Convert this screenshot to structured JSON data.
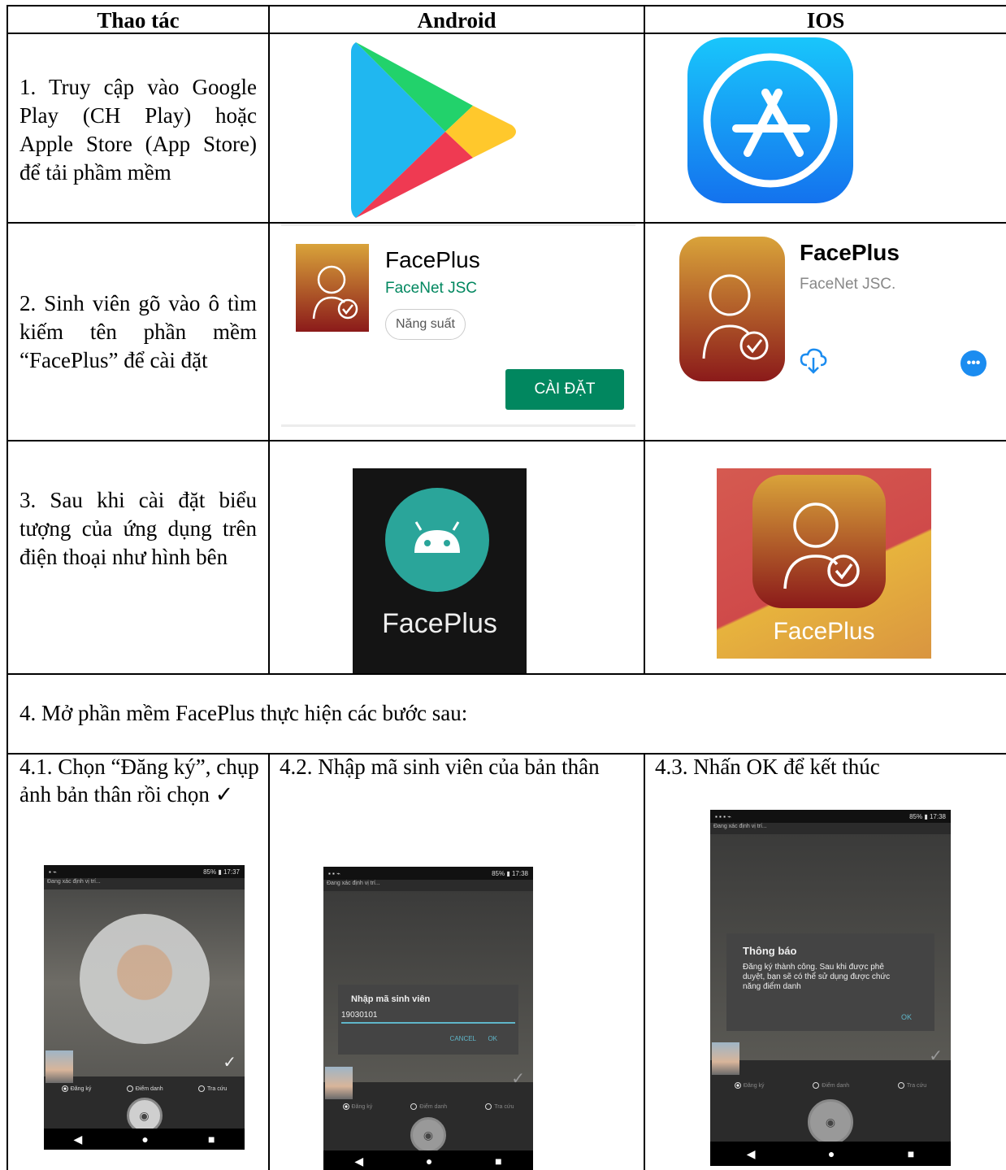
{
  "header": {
    "col1": "Thao tác",
    "col2": "Android",
    "col3": "IOS"
  },
  "row1": {
    "text": "1. Truy cập vào Google Play (CH Play) hoặc Apple Store (App Store) để tải phầm mềm"
  },
  "row2": {
    "text": "2. Sinh viên gõ vào ô tìm kiếm tên phần mềm “FacePlus” để cài đặt",
    "android": {
      "app_name": "FacePlus",
      "developer": "FaceNet JSC",
      "chip": "Năng suất",
      "install": "CÀI ĐẶT"
    },
    "ios": {
      "app_name": "FacePlus",
      "developer": "FaceNet JSC."
    }
  },
  "row3": {
    "text": "3. Sau khi cài đặt biểu tượng của ứng dụng trên điện thoại như hình bên",
    "android_label": "FacePlus",
    "ios_label": "FacePlus"
  },
  "row4": {
    "text": "4. Mở phần mềm FacePlus thực hiện các bước sau:"
  },
  "row5": {
    "step1": "4.1. Chọn “Đăng ký”, chụp ảnh bản thân rồi chọn ✓",
    "step2": "4.2. Nhập mã sinh viên của bản thân",
    "step3": "4.3. Nhấn OK để kết thúc"
  },
  "phones": {
    "locating": "Đang xác định vị trí...",
    "time1": "17:37",
    "time2": "17:38",
    "battery": "85%",
    "radio_register": "Đăng ký",
    "radio_attend": "Điểm danh",
    "radio_lookup": "Tra cứu",
    "dialog_title": "Nhập mã sinh viên",
    "dialog_value": "19030101",
    "dialog_cancel": "CANCEL",
    "dialog_ok": "OK",
    "notice_title": "Thông báo",
    "notice_body": "Đăng ký thành công. Sau khi được phê duyệt, bạn sẽ có thể sử dụng được chức năng điểm danh",
    "notice_ok": "OK"
  },
  "colors": {
    "brand_gradient_top": "#d9a33a",
    "brand_gradient_bottom": "#8b1a1a",
    "install_green": "#01875f",
    "appstore_blue": "#1b8cf0"
  }
}
